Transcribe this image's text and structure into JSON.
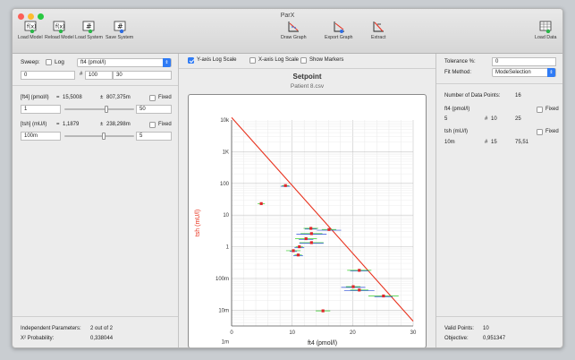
{
  "window": {
    "title": "ParX"
  },
  "toolbar": {
    "load_model": "Load Model",
    "reload_model": "Reload Model",
    "load_system": "Load System",
    "save_system": "Save System",
    "draw_graph": "Draw Graph",
    "export_graph": "Export Graph",
    "extract": "Extract",
    "load_data": "Load Data"
  },
  "left": {
    "sweep_label": "Sweep:",
    "log_label": "Log",
    "sweep_select": "ft4 (pmol/l)",
    "sweep_from": "0",
    "sweep_count_symbol": "#",
    "sweep_count": "100",
    "sweep_to": "30",
    "params": [
      {
        "name": "[ft4] (pmol/l)",
        "eq": "=",
        "value": "15,5008",
        "pm": "±",
        "err": "807,375m",
        "fixed": "Fixed",
        "min": "1",
        "max": "50"
      },
      {
        "name": "[tsh] (mU/l)",
        "eq": "=",
        "value": "1,1879",
        "pm": "±",
        "err": "238,298m",
        "fixed": "Fixed",
        "min": "100m",
        "max": "5"
      }
    ],
    "indep_label": "Independent Parameters:",
    "indep_value": "2 out of 2",
    "chi_label": "X² Probability:",
    "chi_value": "0,338044"
  },
  "mid": {
    "y_log": "Y-axis Log Scale",
    "x_log": "X-axis Log Scale",
    "show_markers": "Show Markers"
  },
  "right": {
    "tolerance_label": "Tolerance %:",
    "tolerance_value": "0",
    "fit_label": "Fit Method:",
    "fit_value": "ModeSelection",
    "ndp_label": "Number of Data Points:",
    "ndp_value": "16",
    "ft4_label": "ft4 (pmol/l)",
    "ft4_fixed": "Fixed",
    "ft4_a": "5",
    "ft4_count_symbol": "#",
    "ft4_count": "10",
    "ft4_b": "25",
    "tsh_label": "tsh (mU/l)",
    "tsh_fixed": "Fixed",
    "tsh_a": "10m",
    "tsh_count_symbol": "#",
    "tsh_count": "15",
    "tsh_b": "75,51",
    "valid_label": "Valid Points:",
    "valid_value": "10",
    "objective_label": "Objective:",
    "objective_value": "0,951347"
  },
  "colors": {
    "accent": "#2f7bf5",
    "fit_line": "#e8321e",
    "x_err": "#2c4fd8",
    "y_err": "#38d12a",
    "point": "#e0262b"
  },
  "chart_data": {
    "type": "scatter",
    "title": "Setpoint",
    "subtitle": "Patient 8.csv",
    "xlabel": "ft4 (pmol/l)",
    "ylabel": "tsh (mU/l)",
    "xlim": [
      0,
      30
    ],
    "ylim_log10": [
      -2.5,
      4
    ],
    "y_scale": "log",
    "grid": true,
    "x_ticks": [
      "0",
      "10",
      "20",
      "30"
    ],
    "y_ticks": [
      {
        "v": 10000,
        "label": "10k"
      },
      {
        "v": 1000,
        "label": "1K"
      },
      {
        "v": 100,
        "label": "100"
      },
      {
        "v": 10,
        "label": "10"
      },
      {
        "v": 1,
        "label": "1"
      },
      {
        "v": 0.1,
        "label": "100m"
      },
      {
        "v": 0.01,
        "label": "10m"
      },
      {
        "v": 0.001,
        "label": "1m"
      }
    ],
    "fit_line": {
      "x": [
        0,
        30
      ],
      "y": [
        12000,
        0.0045
      ]
    },
    "points": [
      {
        "x": 4.9,
        "y": 23,
        "xerr": 0.6,
        "yerr": 0
      },
      {
        "x": 8.9,
        "y": 85,
        "xerr": 0.6,
        "yerr": 0.8
      },
      {
        "x": 13.1,
        "y": 3.8,
        "xerr": 1.2,
        "yerr": 1.0
      },
      {
        "x": 13.2,
        "y": 2.6,
        "xerr": 1.8,
        "yerr": 2.5
      },
      {
        "x": 16.1,
        "y": 3.5,
        "xerr": 1.2,
        "yerr": 2.0
      },
      {
        "x": 12.3,
        "y": 1.8,
        "xerr": 1.8,
        "yerr": 1.2
      },
      {
        "x": 13.2,
        "y": 1.35,
        "xerr": 2.0,
        "yerr": 2.0
      },
      {
        "x": 11.2,
        "y": 1.0,
        "xerr": 0.6,
        "yerr": 0.8
      },
      {
        "x": 10.2,
        "y": 0.75,
        "xerr": 1.2,
        "yerr": 0.6
      },
      {
        "x": 11.0,
        "y": 0.55,
        "xerr": 0.6,
        "yerr": 0.8
      },
      {
        "x": 21.1,
        "y": 0.18,
        "xerr": 2.0,
        "yerr": 1.5
      },
      {
        "x": 20.1,
        "y": 0.055,
        "xerr": 1.2,
        "yerr": 2.0
      },
      {
        "x": 21.1,
        "y": 0.043,
        "xerr": 1.5,
        "yerr": 2.5
      },
      {
        "x": 25.1,
        "y": 0.028,
        "xerr": 2.5,
        "yerr": 1.5
      },
      {
        "x": 15.1,
        "y": 0.0095,
        "xerr": 1.2,
        "yerr": 0
      }
    ]
  }
}
